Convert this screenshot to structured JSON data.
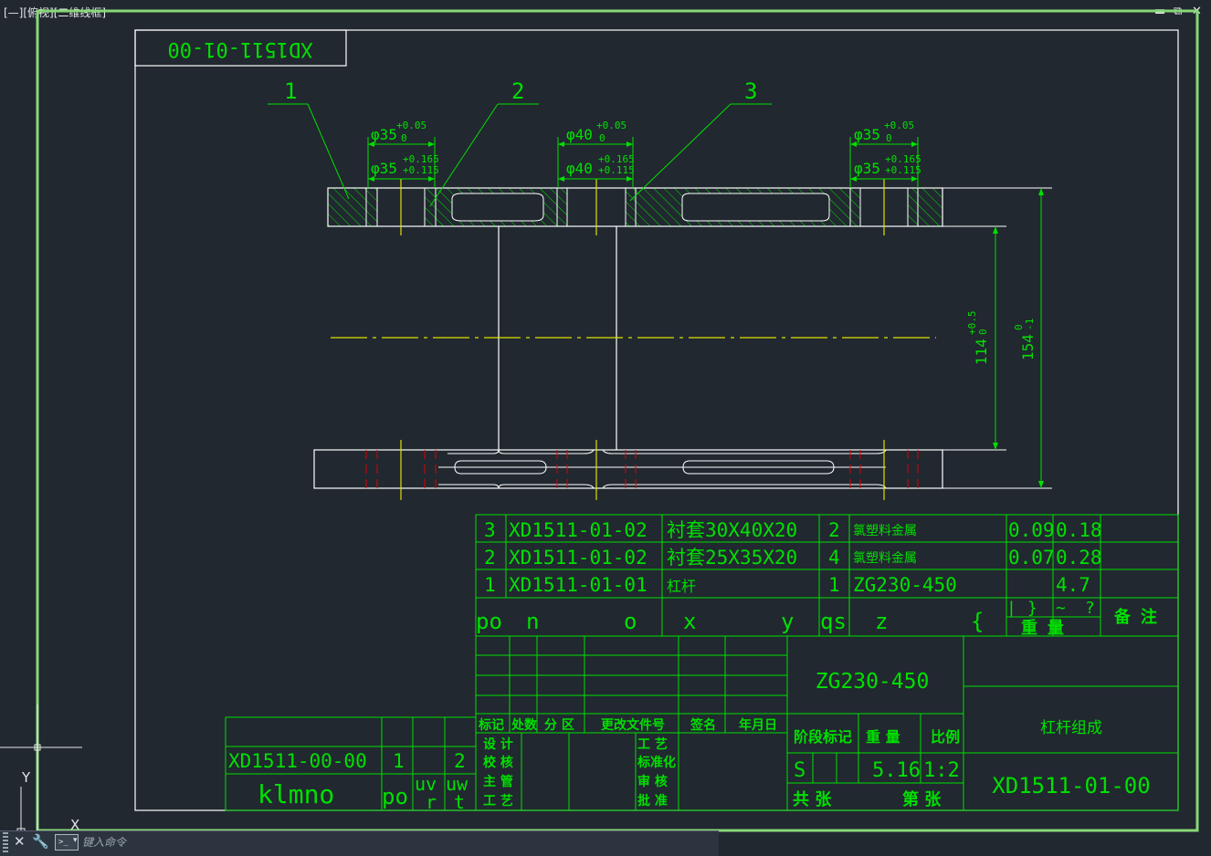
{
  "viewport": {
    "label": "[—][俯视][二维线框]",
    "minimize_icon": "minimize-icon",
    "restore_icon": "restore-icon",
    "close_icon": "close-icon"
  },
  "drawing": {
    "title_tab": "XD1511-01-00",
    "balloons": [
      "1",
      "2",
      "3"
    ],
    "dims": {
      "d1_a_main": "φ35",
      "d1_a_tol_up": "+0.05",
      "d1_a_tol_lo": "0",
      "d1_b_main": "φ35",
      "d1_b_tol_up": "+0.165",
      "d1_b_tol_lo": "+0.115",
      "d2_a_main": "φ40",
      "d2_a_tol_up": "+0.05",
      "d2_a_tol_lo": "0",
      "d2_b_main": "φ40",
      "d2_b_tol_up": "+0.165",
      "d2_b_tol_lo": "+0.115",
      "d3_a_main": "φ35",
      "d3_a_tol_up": "+0.05",
      "d3_a_tol_lo": "0",
      "d3_b_main": "φ35",
      "d3_b_tol_up": "+0.165",
      "d3_b_tol_lo": "+0.115",
      "v114_main": "114",
      "v114_tol_up": "+0.5",
      "v114_tol_lo": "0",
      "v154_main": "154",
      "v154_tol_up": "0",
      "v154_tol_lo": "-1"
    },
    "bom": {
      "rows": [
        {
          "no": "3",
          "code": "XD1511-01-02",
          "name": "衬套30X40X20",
          "qty": "2",
          "material": "氯塑料金属",
          "unit_wt": "0.09",
          "total_wt": "0.18"
        },
        {
          "no": "2",
          "code": "XD1511-01-02",
          "name": "衬套25X35X20",
          "qty": "4",
          "material": "氯塑料金属",
          "unit_wt": "0.07",
          "total_wt": "0.28"
        },
        {
          "no": "1",
          "code": "XD1511-01-01",
          "name": "杠杆",
          "qty": "1",
          "material": "ZG230-450",
          "unit_wt": "",
          "total_wt": "4.7"
        }
      ],
      "header": {
        "c1": "po",
        "c2": "n",
        "c3": "o",
        "c4": "x",
        "c5": "y",
        "c6": "qs",
        "c7": "z",
        "c8": "{",
        "c9a": "|",
        "c9b": "}",
        "c10a": "~",
        "c10b": "?",
        "weight": "重  量",
        "remarks": "备 注"
      }
    },
    "title_block": {
      "material": "ZG230-450",
      "part_name": "杠杆组成",
      "drawing_no": "XD1511-01-00",
      "rev_headers": [
        "标记",
        "处数",
        "分 区",
        "更改文件号",
        "签名",
        "年月日"
      ],
      "sign_labels_left": [
        "设 计",
        "校 核",
        "主 管",
        "工 艺"
      ],
      "sign_labels_right": [
        "工 艺",
        "标准化",
        "审 核",
        "批 准"
      ],
      "stage_label": "阶段标记",
      "weight_label": "重  量",
      "scale_label": "比例",
      "stage_value": "S",
      "weight_value": "5.16",
      "scale_value": "1:2",
      "sheets_total": "共   张",
      "sheet_no": "第   张"
    },
    "side_block": {
      "code": "XD1511-00-00",
      "qty1": "1",
      "qty2": "2",
      "chars": "klmno",
      "po": "po",
      "uv": "uv",
      "uw": "uw",
      "r": "r",
      "t": "t"
    }
  },
  "ucs": {
    "y_label": "Y",
    "x_label": "X"
  },
  "command": {
    "placeholder": "键入命令"
  },
  "colors": {
    "background": "#212830",
    "frame": "#ffffff",
    "green": "#00e000",
    "yellow": "#e0e000",
    "red": "#e00000",
    "viewport_border": "#88d878"
  }
}
